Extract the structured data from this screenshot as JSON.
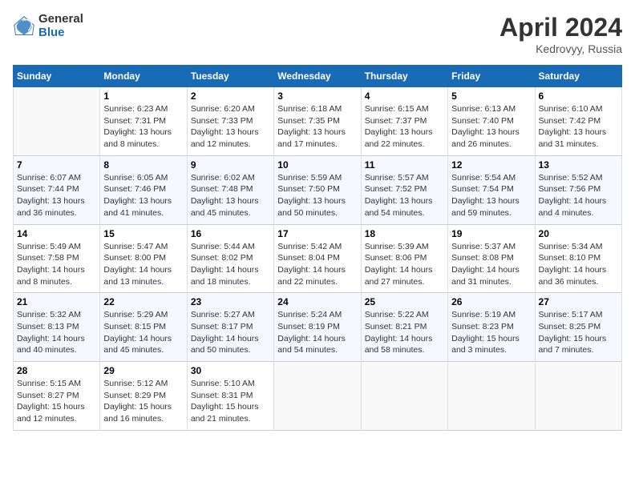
{
  "header": {
    "logo_general": "General",
    "logo_blue": "Blue",
    "title": "April 2024",
    "location": "Kedrovyy, Russia"
  },
  "weekdays": [
    "Sunday",
    "Monday",
    "Tuesday",
    "Wednesday",
    "Thursday",
    "Friday",
    "Saturday"
  ],
  "weeks": [
    [
      {
        "day": "",
        "info": ""
      },
      {
        "day": "1",
        "info": "Sunrise: 6:23 AM\nSunset: 7:31 PM\nDaylight: 13 hours\nand 8 minutes."
      },
      {
        "day": "2",
        "info": "Sunrise: 6:20 AM\nSunset: 7:33 PM\nDaylight: 13 hours\nand 12 minutes."
      },
      {
        "day": "3",
        "info": "Sunrise: 6:18 AM\nSunset: 7:35 PM\nDaylight: 13 hours\nand 17 minutes."
      },
      {
        "day": "4",
        "info": "Sunrise: 6:15 AM\nSunset: 7:37 PM\nDaylight: 13 hours\nand 22 minutes."
      },
      {
        "day": "5",
        "info": "Sunrise: 6:13 AM\nSunset: 7:40 PM\nDaylight: 13 hours\nand 26 minutes."
      },
      {
        "day": "6",
        "info": "Sunrise: 6:10 AM\nSunset: 7:42 PM\nDaylight: 13 hours\nand 31 minutes."
      }
    ],
    [
      {
        "day": "7",
        "info": "Sunrise: 6:07 AM\nSunset: 7:44 PM\nDaylight: 13 hours\nand 36 minutes."
      },
      {
        "day": "8",
        "info": "Sunrise: 6:05 AM\nSunset: 7:46 PM\nDaylight: 13 hours\nand 41 minutes."
      },
      {
        "day": "9",
        "info": "Sunrise: 6:02 AM\nSunset: 7:48 PM\nDaylight: 13 hours\nand 45 minutes."
      },
      {
        "day": "10",
        "info": "Sunrise: 5:59 AM\nSunset: 7:50 PM\nDaylight: 13 hours\nand 50 minutes."
      },
      {
        "day": "11",
        "info": "Sunrise: 5:57 AM\nSunset: 7:52 PM\nDaylight: 13 hours\nand 54 minutes."
      },
      {
        "day": "12",
        "info": "Sunrise: 5:54 AM\nSunset: 7:54 PM\nDaylight: 13 hours\nand 59 minutes."
      },
      {
        "day": "13",
        "info": "Sunrise: 5:52 AM\nSunset: 7:56 PM\nDaylight: 14 hours\nand 4 minutes."
      }
    ],
    [
      {
        "day": "14",
        "info": "Sunrise: 5:49 AM\nSunset: 7:58 PM\nDaylight: 14 hours\nand 8 minutes."
      },
      {
        "day": "15",
        "info": "Sunrise: 5:47 AM\nSunset: 8:00 PM\nDaylight: 14 hours\nand 13 minutes."
      },
      {
        "day": "16",
        "info": "Sunrise: 5:44 AM\nSunset: 8:02 PM\nDaylight: 14 hours\nand 18 minutes."
      },
      {
        "day": "17",
        "info": "Sunrise: 5:42 AM\nSunset: 8:04 PM\nDaylight: 14 hours\nand 22 minutes."
      },
      {
        "day": "18",
        "info": "Sunrise: 5:39 AM\nSunset: 8:06 PM\nDaylight: 14 hours\nand 27 minutes."
      },
      {
        "day": "19",
        "info": "Sunrise: 5:37 AM\nSunset: 8:08 PM\nDaylight: 14 hours\nand 31 minutes."
      },
      {
        "day": "20",
        "info": "Sunrise: 5:34 AM\nSunset: 8:10 PM\nDaylight: 14 hours\nand 36 minutes."
      }
    ],
    [
      {
        "day": "21",
        "info": "Sunrise: 5:32 AM\nSunset: 8:13 PM\nDaylight: 14 hours\nand 40 minutes."
      },
      {
        "day": "22",
        "info": "Sunrise: 5:29 AM\nSunset: 8:15 PM\nDaylight: 14 hours\nand 45 minutes."
      },
      {
        "day": "23",
        "info": "Sunrise: 5:27 AM\nSunset: 8:17 PM\nDaylight: 14 hours\nand 50 minutes."
      },
      {
        "day": "24",
        "info": "Sunrise: 5:24 AM\nSunset: 8:19 PM\nDaylight: 14 hours\nand 54 minutes."
      },
      {
        "day": "25",
        "info": "Sunrise: 5:22 AM\nSunset: 8:21 PM\nDaylight: 14 hours\nand 58 minutes."
      },
      {
        "day": "26",
        "info": "Sunrise: 5:19 AM\nSunset: 8:23 PM\nDaylight: 15 hours\nand 3 minutes."
      },
      {
        "day": "27",
        "info": "Sunrise: 5:17 AM\nSunset: 8:25 PM\nDaylight: 15 hours\nand 7 minutes."
      }
    ],
    [
      {
        "day": "28",
        "info": "Sunrise: 5:15 AM\nSunset: 8:27 PM\nDaylight: 15 hours\nand 12 minutes."
      },
      {
        "day": "29",
        "info": "Sunrise: 5:12 AM\nSunset: 8:29 PM\nDaylight: 15 hours\nand 16 minutes."
      },
      {
        "day": "30",
        "info": "Sunrise: 5:10 AM\nSunset: 8:31 PM\nDaylight: 15 hours\nand 21 minutes."
      },
      {
        "day": "",
        "info": ""
      },
      {
        "day": "",
        "info": ""
      },
      {
        "day": "",
        "info": ""
      },
      {
        "day": "",
        "info": ""
      }
    ]
  ]
}
